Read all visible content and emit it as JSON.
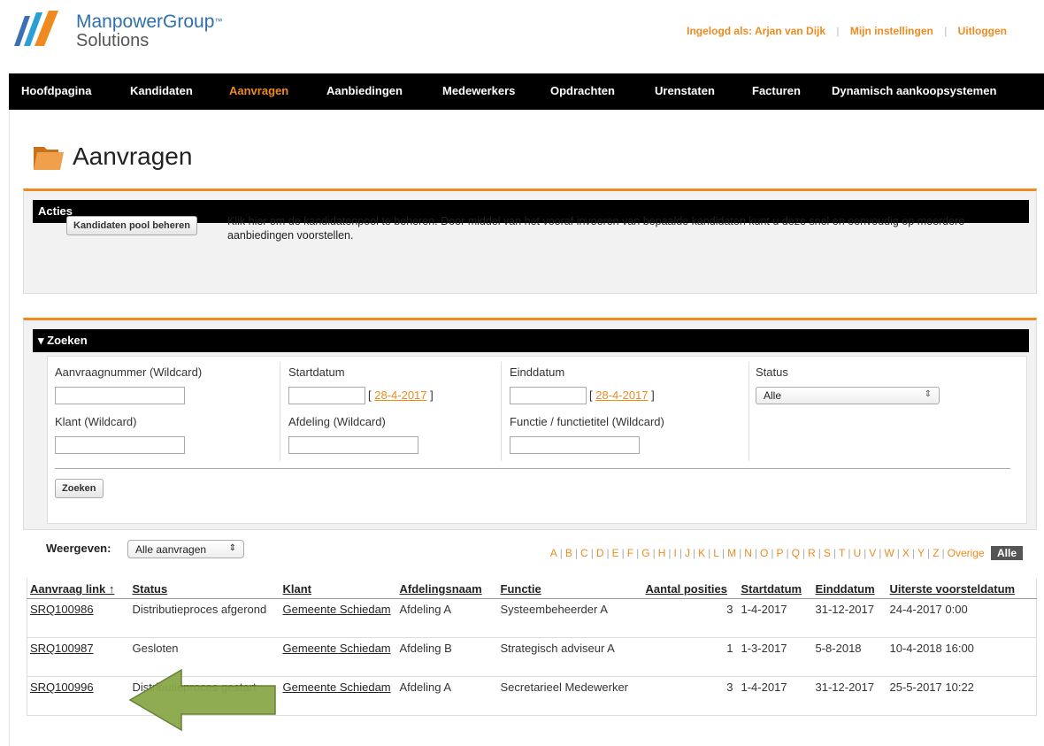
{
  "header": {
    "brand_line1": "ManpowerGroup",
    "brand_tm": "™",
    "brand_line2": "Solutions",
    "logged_in": "Ingelogd als: Arjan van Dijk",
    "settings": "Mijn instellingen",
    "logout": "Uitloggen",
    "colors": {
      "accent": "#ee8a1e",
      "brand_blue": "#2f6fab",
      "nav_bg": "#000000"
    }
  },
  "nav": {
    "items": [
      "Hoofdpagina",
      "Kandidaten",
      "Aanvragen",
      "Aanbiedingen",
      "Medewerkers",
      "Opdrachten",
      "Urenstaten",
      "Facturen",
      "Dynamisch aankoopsystemen"
    ],
    "active": "Aanvragen"
  },
  "page": {
    "title": "Aanvragen",
    "icon": "folder-icon"
  },
  "acties": {
    "heading": "Acties",
    "button": "Kandidaten pool beheren",
    "description": "Klik hier om de kandidatenpool te beheren. Door middel van het vooraf invoeren van bepaalde kandidaten kunt u deze snel en eenvoudig op meerdere aanbiedingen voorstellen."
  },
  "zoeken": {
    "heading": "▾ Zoeken",
    "labels": {
      "aanvraagnummer": "Aanvraagnummer (Wildcard)",
      "startdatum": "Startdatum",
      "einddatum": "Einddatum",
      "status": "Status",
      "klant": "Klant (Wildcard)",
      "afdeling": "Afdeling (Wildcard)",
      "functie": "Functie / functietitel (Wildcard)"
    },
    "date_today": "28-4-2017",
    "bracket_open": "[",
    "bracket_close": "]",
    "status_value": "Alle",
    "submit": "Zoeken"
  },
  "weergeven": {
    "label": "Weergeven:",
    "value": "Alle aanvragen",
    "letters": [
      "A",
      "B",
      "C",
      "D",
      "E",
      "F",
      "G",
      "H",
      "I",
      "J",
      "K",
      "L",
      "M",
      "N",
      "O",
      "P",
      "Q",
      "R",
      "S",
      "T",
      "U",
      "V",
      "W",
      "X",
      "Y",
      "Z",
      "Overige"
    ],
    "all": "Alle"
  },
  "table": {
    "headers": [
      "Aanvraag link ↑",
      "Status",
      "Klant",
      "Afdelingsnaam",
      "Functie",
      "Aantal posities",
      "Startdatum",
      "Einddatum",
      "Uiterste voorsteldatum"
    ],
    "rows": [
      {
        "link": "SRQ100986",
        "status": "Distributieproces afgerond",
        "klant": "Gemeente Schiedam",
        "afdeling": "Afdeling A",
        "functie": "Systeembeheerder A",
        "posities": "3",
        "start": "1-4-2017",
        "eind": "31-12-2017",
        "uiterste": "24-4-2017 0:00"
      },
      {
        "link": "SRQ100987",
        "status": "Gesloten",
        "klant": "Gemeente Schiedam",
        "afdeling": "Afdeling B",
        "functie": "Strategisch adviseur A",
        "posities": "1",
        "start": "1-3-2017",
        "eind": "5-8-2018",
        "uiterste": "10-4-2018 16:00"
      },
      {
        "link": "SRQ100996",
        "status": "Distributieproces gestart",
        "klant": "Gemeente Schiedam",
        "afdeling": "Afdeling A",
        "functie": "Secretarieel Medewerker",
        "posities": "3",
        "start": "1-4-2017",
        "eind": "31-12-2017",
        "uiterste": "25-5-2017 10:22"
      }
    ]
  },
  "annotation": {
    "arrow_color": "#8aa84a"
  }
}
